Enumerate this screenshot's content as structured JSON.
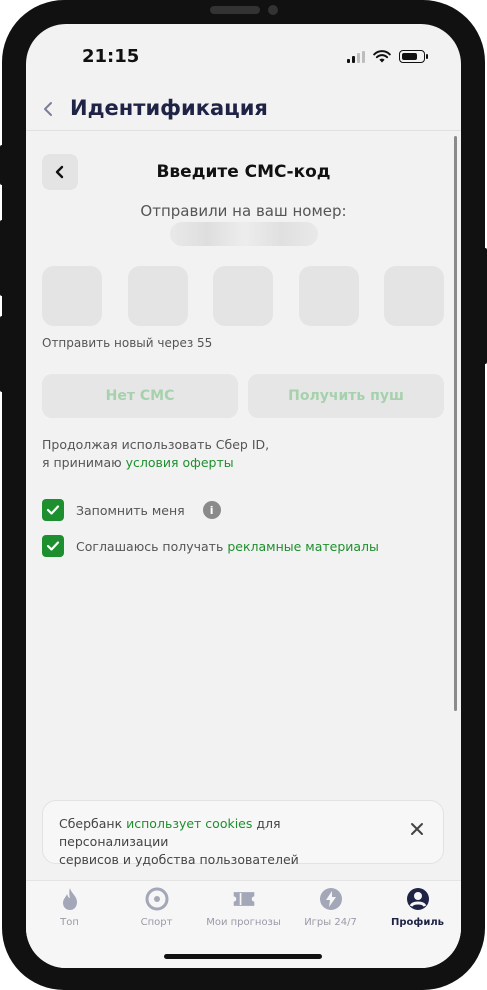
{
  "status_bar": {
    "time": "21:15"
  },
  "header": {
    "title": "Идентификация"
  },
  "sms": {
    "title": "Введите СМС-код",
    "sent_label": "Отправили на ваш номер:",
    "resend_text": "Отправить новый через 55"
  },
  "actions": {
    "no_sms": "Нет СМС",
    "get_push": "Получить пуш"
  },
  "consent": {
    "line1": "Продолжая использовать Сбер ID,",
    "line2_prefix": "я принимаю ",
    "link": "условия оферты"
  },
  "checkboxes": {
    "remember": {
      "label": "Запомнить меня",
      "checked": true
    },
    "ads": {
      "label_prefix": "Соглашаюсь получать ",
      "link": "рекламные материалы",
      "checked": true
    }
  },
  "cookie": {
    "prefix": "Сбербанк ",
    "link": "использует cookies",
    "suffix_line1": " для персонализации",
    "line2": "сервисов и удобства пользователей"
  },
  "nav": {
    "items": [
      {
        "label": "Топ",
        "icon": "flame-icon"
      },
      {
        "label": "Спорт",
        "icon": "target-icon"
      },
      {
        "label": "Мои прогнозы",
        "icon": "ticket-icon"
      },
      {
        "label": "Игры 24/7",
        "icon": "lightning-icon"
      },
      {
        "label": "Профиль",
        "icon": "profile-icon",
        "active": true
      }
    ]
  },
  "colors": {
    "accent": "#1e8f2e",
    "title": "#1f2346",
    "background": "#f2f2f2"
  }
}
